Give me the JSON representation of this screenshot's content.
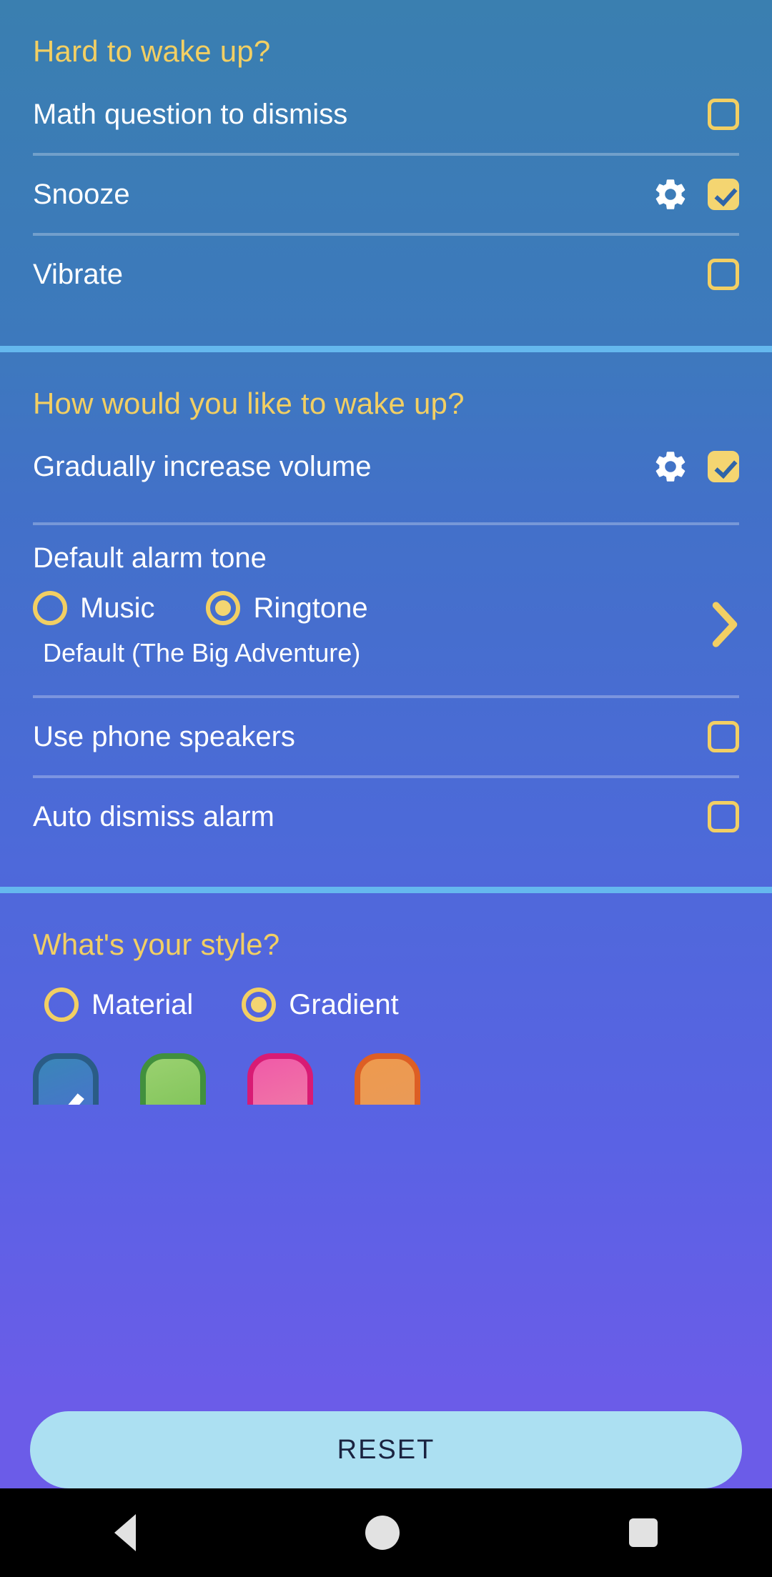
{
  "theme": {
    "accent_yellow": "#f2cf63",
    "divider_blue": "#65b8ee",
    "reset_bg": "#ace0f2",
    "bg_top": "#3a7fb0",
    "bg_bottom": "#6b5ce8"
  },
  "sections": [
    {
      "title": "Hard to wake up?",
      "rows": [
        {
          "label": "Math question to dismiss",
          "has_gear": false,
          "checked": false
        },
        {
          "label": "Snooze",
          "has_gear": true,
          "checked": true
        },
        {
          "label": "Vibrate",
          "has_gear": false,
          "checked": false
        }
      ]
    },
    {
      "title": "How would you like to wake up?",
      "rows": [
        {
          "label": "Gradually increase volume",
          "has_gear": true,
          "checked": true
        }
      ],
      "tone": {
        "label": "Default alarm tone",
        "options": [
          {
            "label": "Music",
            "selected": false
          },
          {
            "label": "Ringtone",
            "selected": true
          }
        ],
        "current": "Default (The Big Adventure)"
      },
      "rows2": [
        {
          "label": "Use phone speakers",
          "has_gear": false,
          "checked": false
        },
        {
          "label": "Auto dismiss alarm",
          "has_gear": false,
          "checked": false
        }
      ]
    },
    {
      "title": "What's your style?",
      "style_options": [
        {
          "label": "Material",
          "selected": false
        },
        {
          "label": "Gradient",
          "selected": true
        }
      ],
      "swatches": [
        {
          "name": "blue",
          "color_top": "#3a86b8",
          "color_bottom": "#4b6fd0",
          "border": "#2a5c86",
          "selected": true
        },
        {
          "name": "green",
          "color_top": "#9ad170",
          "color_bottom": "#7cc155",
          "border": "#41903d",
          "selected": false
        },
        {
          "name": "pink",
          "color_top": "#f05aa8",
          "color_bottom": "#ef7fa6",
          "border": "#d81b74",
          "selected": false
        },
        {
          "name": "orange",
          "color_top": "#ee9a4e",
          "color_bottom": "#e89a5a",
          "border": "#dd5e24",
          "selected": false
        }
      ]
    }
  ],
  "reset": {
    "label": "RESET"
  },
  "navbar": {
    "back": "back-button",
    "home": "home-button",
    "recent": "recents-button"
  }
}
